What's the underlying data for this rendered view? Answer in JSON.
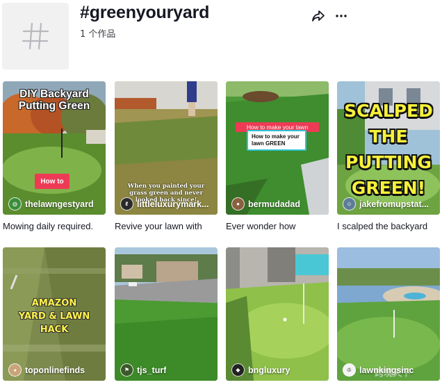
{
  "header": {
    "title": "#greenyouryard",
    "subtitle": "1 个作品",
    "hashtag_icon": "hashtag-icon",
    "share_icon": "share-icon",
    "more_icon": "more-icon"
  },
  "videos": [
    {
      "author": "thelawngestyard",
      "caption": "Mowing daily required.",
      "overlay_title": "DIY Backyard Putting Green",
      "overlay_badge": "How to"
    },
    {
      "author": "littleluxurymark...",
      "caption": "Revive your lawn with",
      "overlay_text": "When you painted your grass green and never looked back since!"
    },
    {
      "author": "bermudadad",
      "caption": "Ever wonder how",
      "overlay_pill": "How to make your lawn",
      "overlay_box": "How to make your lawn GREEN"
    },
    {
      "author": "jakefromupstat...",
      "caption": "I scalped the backyard",
      "overlay_lines": [
        "SCALPED",
        "THE",
        "PUTTING",
        "GREEN!"
      ]
    },
    {
      "author": "toponlinefinds",
      "overlay_lines": [
        "AMAZON",
        "YARD & LAWN",
        "HACK"
      ]
    },
    {
      "author": "tjs_turf"
    },
    {
      "author": "bngluxury"
    },
    {
      "author": "lawnkingsinc",
      "watermark": "跨境天下"
    }
  ],
  "colors": {
    "text_primary": "#161823",
    "tile_bg": "#f1f1f2",
    "accent_pink": "#ee3b55",
    "scalp_yellow": "#f6f13a"
  }
}
